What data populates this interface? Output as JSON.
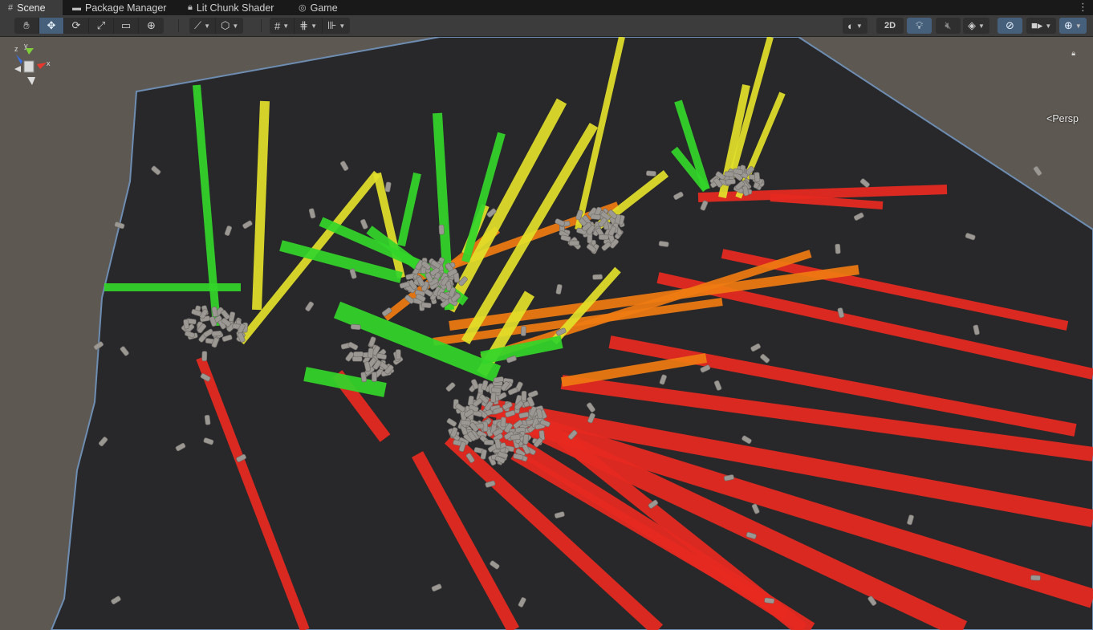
{
  "tabs": [
    {
      "label": "Scene",
      "icon": "grid-icon",
      "active": true
    },
    {
      "label": "Package Manager",
      "icon": "package-icon",
      "active": false
    },
    {
      "label": "Lit Chunk Shader",
      "icon": "shader-lock-icon",
      "active": false
    },
    {
      "label": "Game",
      "icon": "gamepad-icon",
      "active": false
    }
  ],
  "toolbar": {
    "tools": [
      "hand-tool-icon",
      "move-tool-icon",
      "rotate-tool-icon",
      "scale-tool-icon",
      "rect-tool-icon",
      "transform-tool-icon"
    ],
    "active_tool": "move-tool-icon",
    "view_2d_label": "2D"
  },
  "scene": {
    "projection_label": "<Persp",
    "gizmo_axes": {
      "x": "x",
      "y": "y",
      "z": "z"
    }
  },
  "colors": {
    "ground": "#28282b",
    "ground_edge": "#6e8db2",
    "backdrop": "#5d5851",
    "red": "#e82a20",
    "orange": "#f07b12",
    "yellow": "#e3e12a",
    "green": "#33d62a",
    "barrel": "#9b9793",
    "accent": "#46607c"
  }
}
